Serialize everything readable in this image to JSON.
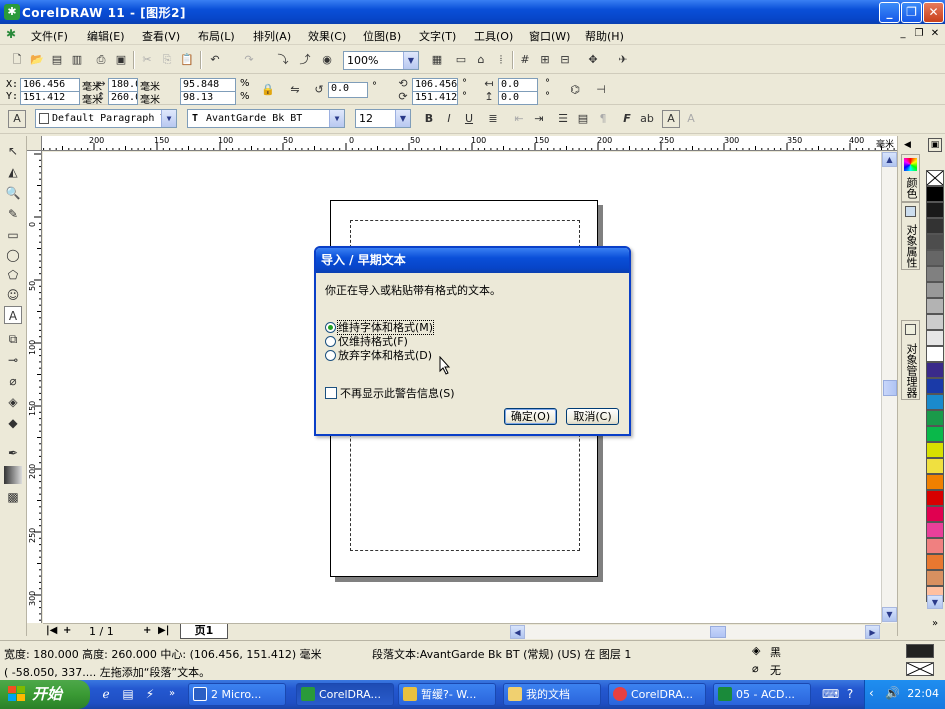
{
  "window": {
    "title": "CorelDRAW 11 - [图形2]",
    "app_icon": "coreldraw-icon"
  },
  "menu": [
    "文件(F)",
    "编辑(E)",
    "查看(V)",
    "布局(L)",
    "排列(A)",
    "效果(C)",
    "位图(B)",
    "文字(T)",
    "工具(O)",
    "窗口(W)",
    "帮助(H)"
  ],
  "standard_toolbar": {
    "zoom": "100%"
  },
  "property_bar": {
    "x_label": "X:",
    "y_label": "Y:",
    "x": "106.456",
    "y": "151.412",
    "pos_unit": "毫米",
    "width": "180.0",
    "height": "260.0",
    "size_unit": "毫米",
    "scale_x": "95.848",
    "scale_y": "98.13",
    "pct": "%",
    "rotation": "0.0",
    "degree": "°",
    "center_x": "106.456",
    "center_y": "151.412",
    "offset_x": "0.0",
    "offset_y": "0.0"
  },
  "text_bar": {
    "style": "Default Paragraph T",
    "font": "AvantGarde Bk BT",
    "size": "12"
  },
  "ruler": {
    "h_labels": [
      "200",
      "150",
      "100",
      "50",
      "0",
      "50",
      "100",
      "150",
      "200",
      "250",
      "300",
      "350",
      "400"
    ],
    "v_labels": [
      "0",
      "50",
      "100",
      "150",
      "200",
      "250",
      "300"
    ],
    "unit": "毫米"
  },
  "dockers": [
    "颜色",
    "对象属性",
    "对象管理器"
  ],
  "palette": [
    "#000000",
    "#1a1a1a",
    "#333333",
    "#4d4d4d",
    "#666666",
    "#808080",
    "#999999",
    "#b3b3b3",
    "#cccccc",
    "#e6e6e6",
    "#ffffff",
    "#3a2a8a",
    "#1a3aa8",
    "#1a8acc",
    "#1a9a4a",
    "#0ab84a",
    "#d8e000",
    "#f0e040",
    "#f08000",
    "#d80000",
    "#e00050",
    "#e8409a",
    "#f08080",
    "#e87830",
    "#d89060",
    "#ffc0a0"
  ],
  "page_nav": {
    "counter": "1 / 1",
    "current_tab": "页1"
  },
  "status": {
    "line1": "宽度: 180.000  高度: 260.000  中心: (106.456, 151.412)  毫米",
    "object_info": "段落文本:AvantGarde Bk BT (常规) (US) 在 图层 1",
    "line2": "( -58.050, 337....  左拖添加“段落”文本。",
    "fill": "黑",
    "outline": "无"
  },
  "dialog": {
    "title": "导入 / 早期文本",
    "message": "你正在导入或粘贴带有格式的文本。",
    "options": [
      {
        "label": "维持字体和格式(M)",
        "selected": true
      },
      {
        "label": "仅维持格式(F)",
        "selected": false
      },
      {
        "label": "放弃字体和格式(D)",
        "selected": false
      }
    ],
    "checkbox_label": "不再显示此警告信息(S)",
    "ok": "确定(O)",
    "cancel": "取消(C)"
  },
  "taskbar": {
    "start": "开始",
    "tasks": [
      "2 Micro...",
      "CorelDRA...",
      "暂缓?- W...",
      "我的文档",
      "CorelDRA...",
      "05 - ACD..."
    ],
    "clock": "22:04"
  }
}
